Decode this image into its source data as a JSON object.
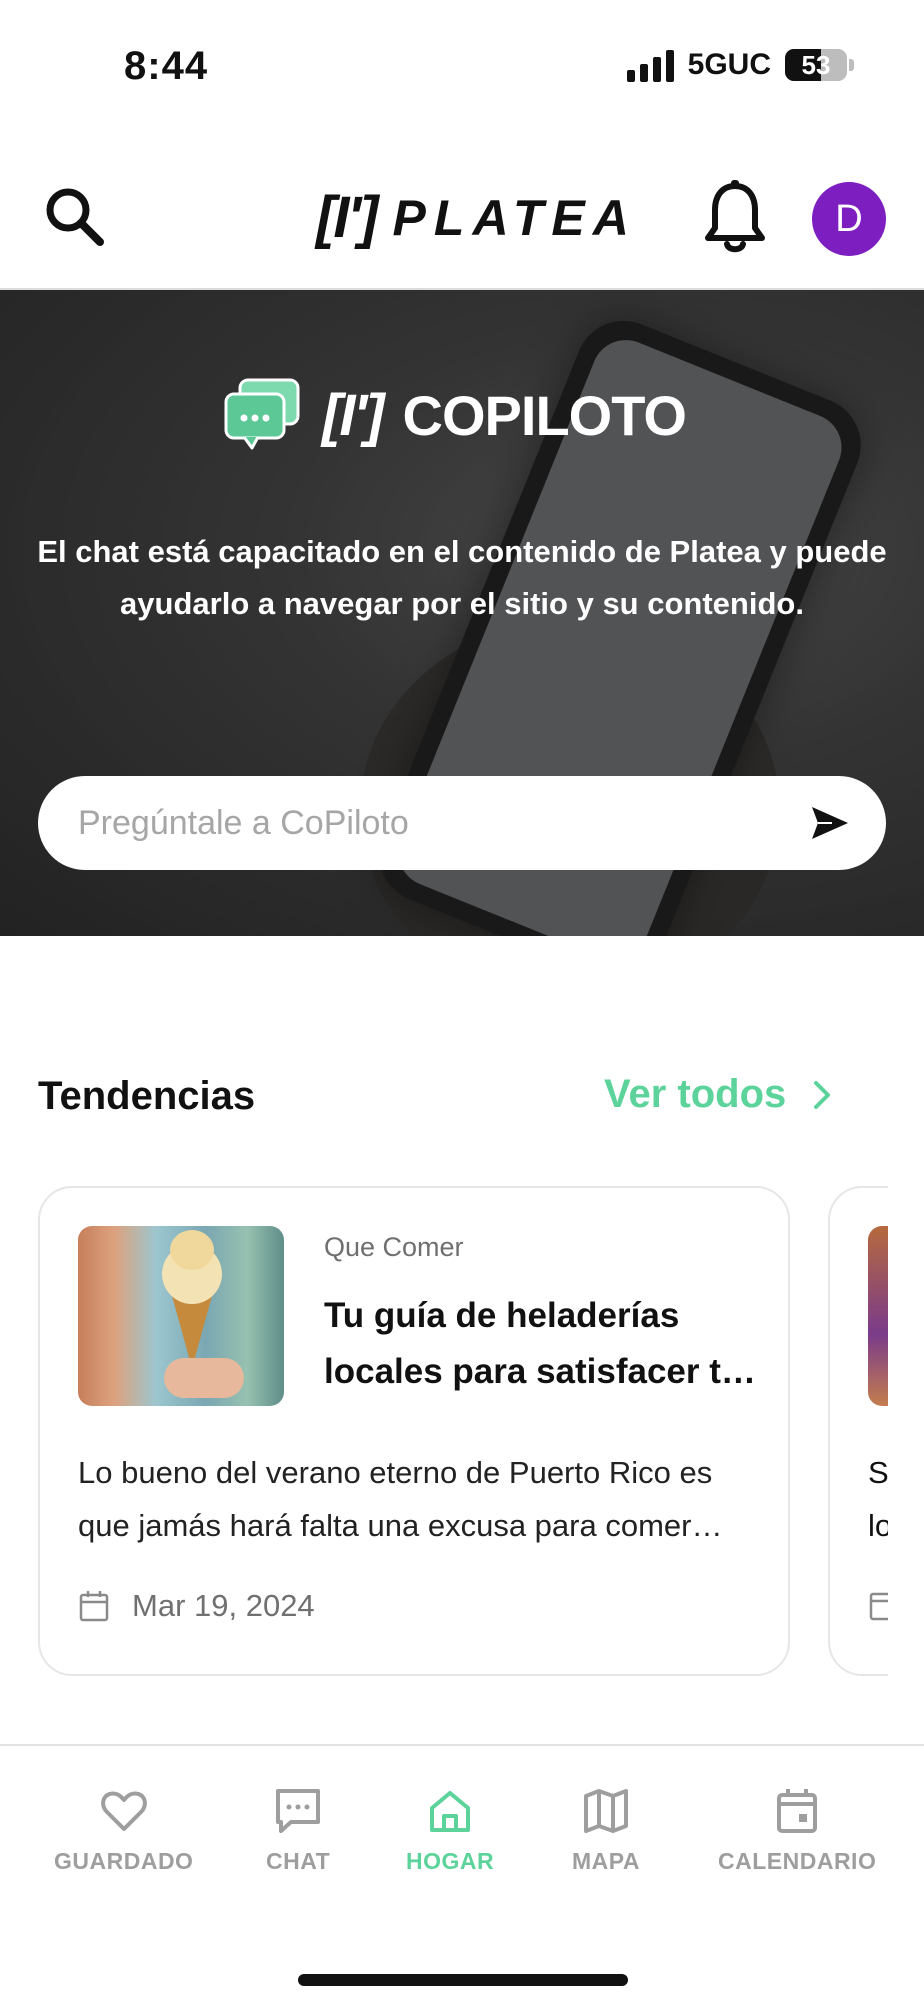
{
  "status_bar": {
    "time": "8:44",
    "network": "5GUC",
    "battery": "53"
  },
  "header": {
    "logo_bracket": "[I']",
    "logo_text": "PLATEA",
    "avatar_initial": "D"
  },
  "copiloto": {
    "brand_bracket": "[I']",
    "title": "COPILOTO",
    "description": "El chat está capacitado en el contenido de Platea y puede ayudarlo a navegar por el sitio y su contenido.",
    "input_placeholder": "Pregúntale a CoPiloto"
  },
  "trending": {
    "title": "Tendencias",
    "see_all": "Ver todos",
    "cards": [
      {
        "category": "Que Comer",
        "title": "Tu guía de heladerías locales para satisfacer tu antojo",
        "description": "Lo bueno del verano eterno de Puerto Rico es que jamás hará falta una excusa para comer helado.",
        "date": "Mar 19, 2024"
      },
      {
        "description_preview": "S\nlo"
      }
    ]
  },
  "bottom_nav": {
    "items": [
      {
        "label": "GUARDADO",
        "icon": "heart-icon",
        "active": false
      },
      {
        "label": "CHAT",
        "icon": "chat-icon",
        "active": false
      },
      {
        "label": "HOGAR",
        "icon": "home-icon",
        "active": true
      },
      {
        "label": "MAPA",
        "icon": "map-icon",
        "active": false
      },
      {
        "label": "CALENDARIO",
        "icon": "calendar-icon",
        "active": false
      }
    ]
  },
  "colors": {
    "accent": "#5cd39a",
    "avatar": "#7d1fc0",
    "nav_inactive": "#9e9e9e"
  }
}
